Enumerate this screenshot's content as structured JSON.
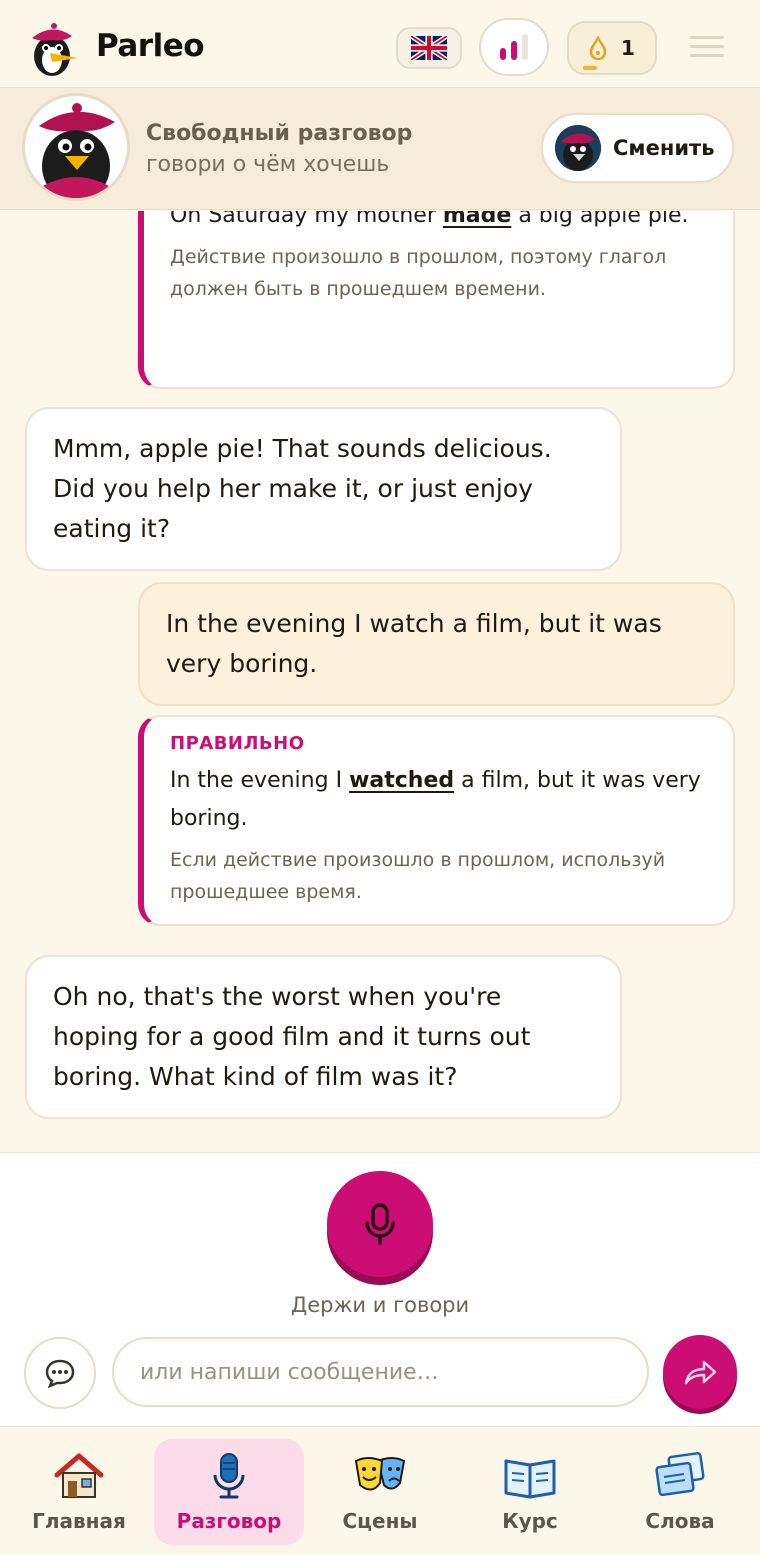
{
  "app": {
    "brand": "Parleo"
  },
  "header": {
    "language_icon": "uk-flag-icon",
    "level_icon": "level-bars-icon",
    "streak_icon": "flame-icon",
    "streak_count": "1",
    "menu_icon": "hamburger-menu-icon"
  },
  "mode": {
    "title": "Свободный разговор",
    "subtitle": "говори о чём хочешь",
    "switch_label": "Сменить"
  },
  "messages": [
    {
      "type": "correction",
      "label": "",
      "before": "On Saturday my mother ",
      "fix": "made",
      "after": " a big apple pie.",
      "note": "Действие произошло в прошлом, поэтому глагол должен быть в прошедшем времени."
    },
    {
      "type": "bot",
      "text": "Mmm, apple pie! That sounds delicious. Did you help her make it, or just enjoy eating it?"
    },
    {
      "type": "user",
      "text": "In the evening I watch a film, but it was very boring."
    },
    {
      "type": "correction",
      "label": "ПРАВИЛЬНО",
      "before": "In the evening I ",
      "fix": "watched",
      "after": " a film, but it was very boring.",
      "note": "Если действие произошло в прошлом, используй прошедшее время."
    },
    {
      "type": "bot",
      "text": "Oh no, that's the worst when you're hoping for a good film and it turns out boring. What kind of film was it?"
    }
  ],
  "input": {
    "hold_label": "Держи и говори",
    "placeholder": "или напиши сообщение…",
    "value": ""
  },
  "nav": {
    "items": [
      {
        "label": "Главная",
        "icon": "house-icon",
        "active": false
      },
      {
        "label": "Разговор",
        "icon": "microphone-icon",
        "active": true
      },
      {
        "label": "Сцены",
        "icon": "theater-masks-icon",
        "active": false
      },
      {
        "label": "Курс",
        "icon": "open-book-icon",
        "active": false
      },
      {
        "label": "Слова",
        "icon": "word-cards-icon",
        "active": false
      }
    ]
  },
  "colors": {
    "accent": "#cc0e74",
    "background": "#fdf7ea",
    "user_bubble": "#fdf0dc"
  }
}
